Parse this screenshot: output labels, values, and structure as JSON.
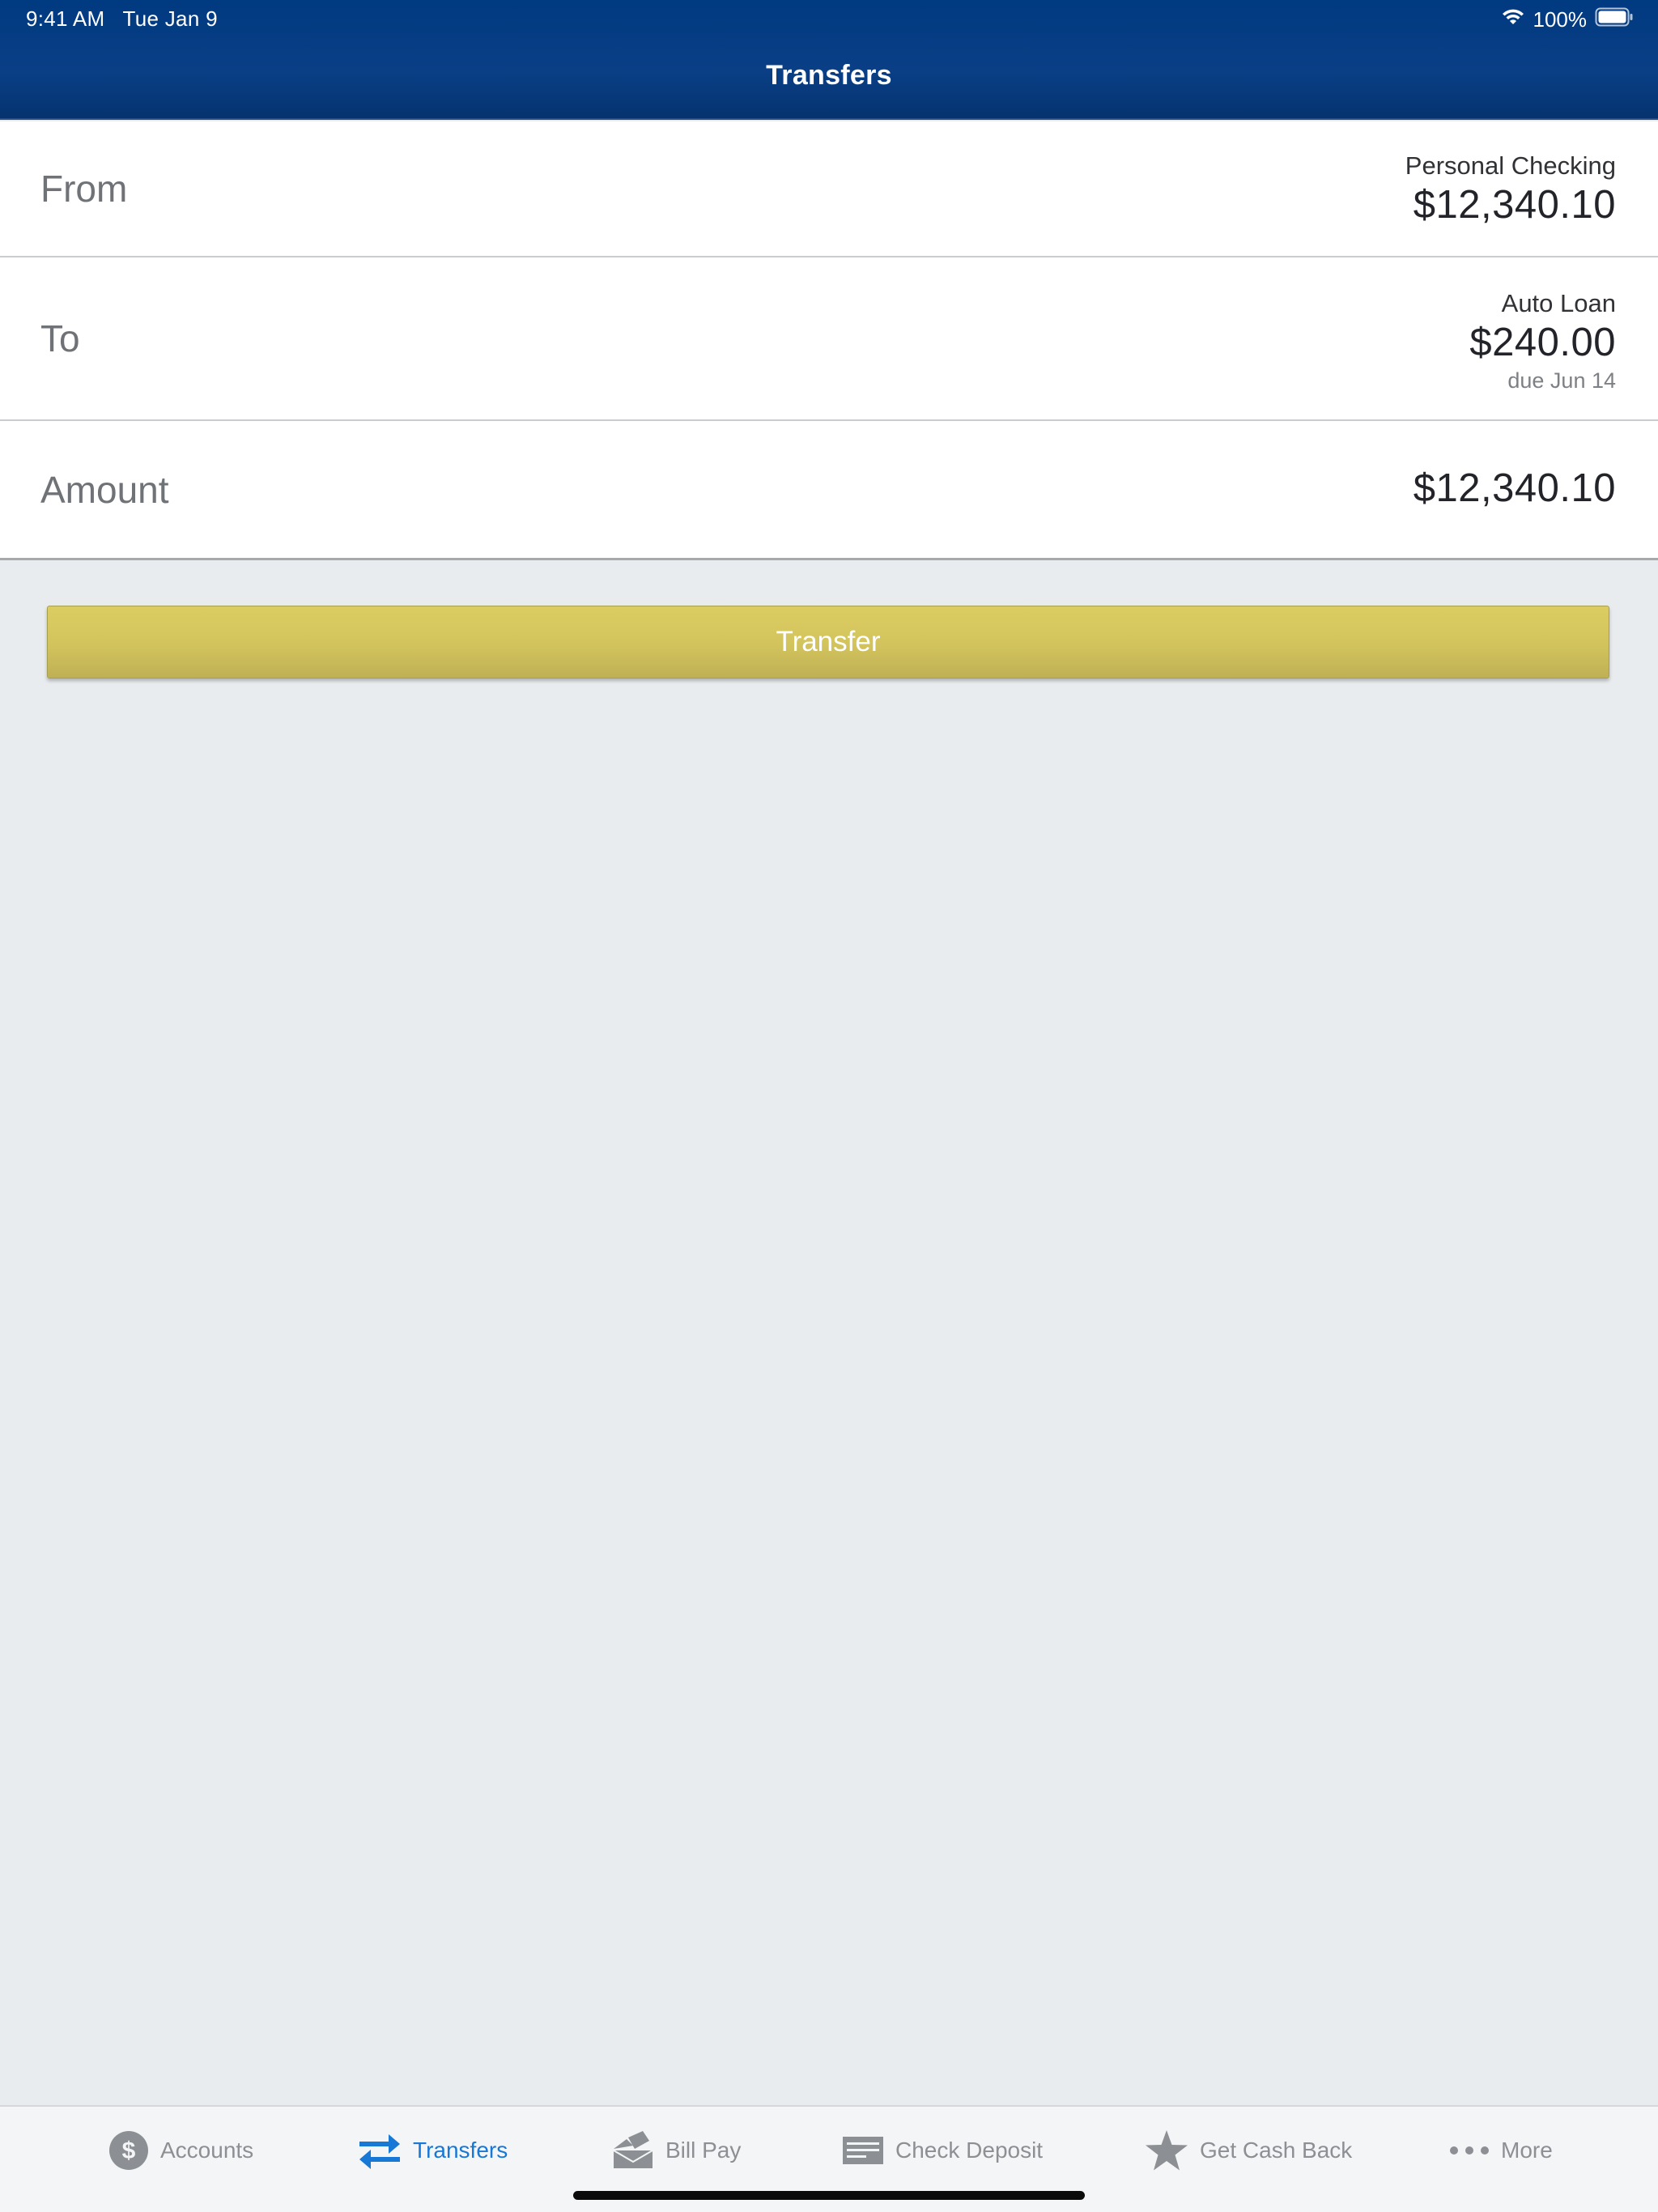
{
  "status_bar": {
    "time": "9:41 AM",
    "date": "Tue Jan 9",
    "battery": "100%"
  },
  "header": {
    "title": "Transfers"
  },
  "form": {
    "from": {
      "label": "From",
      "account_name": "Personal Checking",
      "account_balance": "$12,340.10"
    },
    "to": {
      "label": "To",
      "account_name": "Auto Loan",
      "account_amount": "$240.00",
      "due": "due Jun 14"
    },
    "amount": {
      "label": "Amount",
      "value": "$12,340.10"
    }
  },
  "transfer_button": {
    "label": "Transfer"
  },
  "tabs": [
    {
      "label": "Accounts",
      "icon": "dollar-circle-icon",
      "active": false
    },
    {
      "label": "Transfers",
      "icon": "transfer-arrows-icon",
      "active": true
    },
    {
      "label": "Bill Pay",
      "icon": "envelope-icon",
      "active": false
    },
    {
      "label": "Check Deposit",
      "icon": "check-icon",
      "active": false
    },
    {
      "label": "Get Cash Back",
      "icon": "star-icon",
      "active": false
    },
    {
      "label": "More",
      "icon": "more-dots-icon",
      "active": false
    }
  ],
  "colors": {
    "header": "#003a80",
    "button": "#d2c35c",
    "active_tab": "#1778d6",
    "inactive_tab": "#8c8f93",
    "background": "#e9ecee"
  }
}
